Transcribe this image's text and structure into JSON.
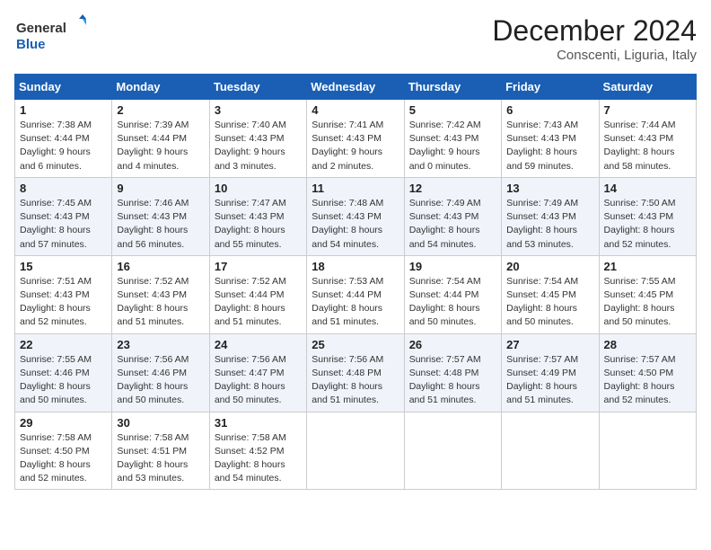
{
  "header": {
    "logo_line1": "General",
    "logo_line2": "Blue",
    "month_title": "December 2024",
    "subtitle": "Conscenti, Liguria, Italy"
  },
  "weekdays": [
    "Sunday",
    "Monday",
    "Tuesday",
    "Wednesday",
    "Thursday",
    "Friday",
    "Saturday"
  ],
  "weeks": [
    [
      {
        "day": "1",
        "sunrise": "7:38 AM",
        "sunset": "4:44 PM",
        "daylight": "9 hours and 6 minutes."
      },
      {
        "day": "2",
        "sunrise": "7:39 AM",
        "sunset": "4:44 PM",
        "daylight": "9 hours and 4 minutes."
      },
      {
        "day": "3",
        "sunrise": "7:40 AM",
        "sunset": "4:43 PM",
        "daylight": "9 hours and 3 minutes."
      },
      {
        "day": "4",
        "sunrise": "7:41 AM",
        "sunset": "4:43 PM",
        "daylight": "9 hours and 2 minutes."
      },
      {
        "day": "5",
        "sunrise": "7:42 AM",
        "sunset": "4:43 PM",
        "daylight": "9 hours and 0 minutes."
      },
      {
        "day": "6",
        "sunrise": "7:43 AM",
        "sunset": "4:43 PM",
        "daylight": "8 hours and 59 minutes."
      },
      {
        "day": "7",
        "sunrise": "7:44 AM",
        "sunset": "4:43 PM",
        "daylight": "8 hours and 58 minutes."
      }
    ],
    [
      {
        "day": "8",
        "sunrise": "7:45 AM",
        "sunset": "4:43 PM",
        "daylight": "8 hours and 57 minutes."
      },
      {
        "day": "9",
        "sunrise": "7:46 AM",
        "sunset": "4:43 PM",
        "daylight": "8 hours and 56 minutes."
      },
      {
        "day": "10",
        "sunrise": "7:47 AM",
        "sunset": "4:43 PM",
        "daylight": "8 hours and 55 minutes."
      },
      {
        "day": "11",
        "sunrise": "7:48 AM",
        "sunset": "4:43 PM",
        "daylight": "8 hours and 54 minutes."
      },
      {
        "day": "12",
        "sunrise": "7:49 AM",
        "sunset": "4:43 PM",
        "daylight": "8 hours and 54 minutes."
      },
      {
        "day": "13",
        "sunrise": "7:49 AM",
        "sunset": "4:43 PM",
        "daylight": "8 hours and 53 minutes."
      },
      {
        "day": "14",
        "sunrise": "7:50 AM",
        "sunset": "4:43 PM",
        "daylight": "8 hours and 52 minutes."
      }
    ],
    [
      {
        "day": "15",
        "sunrise": "7:51 AM",
        "sunset": "4:43 PM",
        "daylight": "8 hours and 52 minutes."
      },
      {
        "day": "16",
        "sunrise": "7:52 AM",
        "sunset": "4:43 PM",
        "daylight": "8 hours and 51 minutes."
      },
      {
        "day": "17",
        "sunrise": "7:52 AM",
        "sunset": "4:44 PM",
        "daylight": "8 hours and 51 minutes."
      },
      {
        "day": "18",
        "sunrise": "7:53 AM",
        "sunset": "4:44 PM",
        "daylight": "8 hours and 51 minutes."
      },
      {
        "day": "19",
        "sunrise": "7:54 AM",
        "sunset": "4:44 PM",
        "daylight": "8 hours and 50 minutes."
      },
      {
        "day": "20",
        "sunrise": "7:54 AM",
        "sunset": "4:45 PM",
        "daylight": "8 hours and 50 minutes."
      },
      {
        "day": "21",
        "sunrise": "7:55 AM",
        "sunset": "4:45 PM",
        "daylight": "8 hours and 50 minutes."
      }
    ],
    [
      {
        "day": "22",
        "sunrise": "7:55 AM",
        "sunset": "4:46 PM",
        "daylight": "8 hours and 50 minutes."
      },
      {
        "day": "23",
        "sunrise": "7:56 AM",
        "sunset": "4:46 PM",
        "daylight": "8 hours and 50 minutes."
      },
      {
        "day": "24",
        "sunrise": "7:56 AM",
        "sunset": "4:47 PM",
        "daylight": "8 hours and 50 minutes."
      },
      {
        "day": "25",
        "sunrise": "7:56 AM",
        "sunset": "4:48 PM",
        "daylight": "8 hours and 51 minutes."
      },
      {
        "day": "26",
        "sunrise": "7:57 AM",
        "sunset": "4:48 PM",
        "daylight": "8 hours and 51 minutes."
      },
      {
        "day": "27",
        "sunrise": "7:57 AM",
        "sunset": "4:49 PM",
        "daylight": "8 hours and 51 minutes."
      },
      {
        "day": "28",
        "sunrise": "7:57 AM",
        "sunset": "4:50 PM",
        "daylight": "8 hours and 52 minutes."
      }
    ],
    [
      {
        "day": "29",
        "sunrise": "7:58 AM",
        "sunset": "4:50 PM",
        "daylight": "8 hours and 52 minutes."
      },
      {
        "day": "30",
        "sunrise": "7:58 AM",
        "sunset": "4:51 PM",
        "daylight": "8 hours and 53 minutes."
      },
      {
        "day": "31",
        "sunrise": "7:58 AM",
        "sunset": "4:52 PM",
        "daylight": "8 hours and 54 minutes."
      },
      null,
      null,
      null,
      null
    ]
  ],
  "labels": {
    "sunrise": "Sunrise:",
    "sunset": "Sunset:",
    "daylight": "Daylight:"
  }
}
